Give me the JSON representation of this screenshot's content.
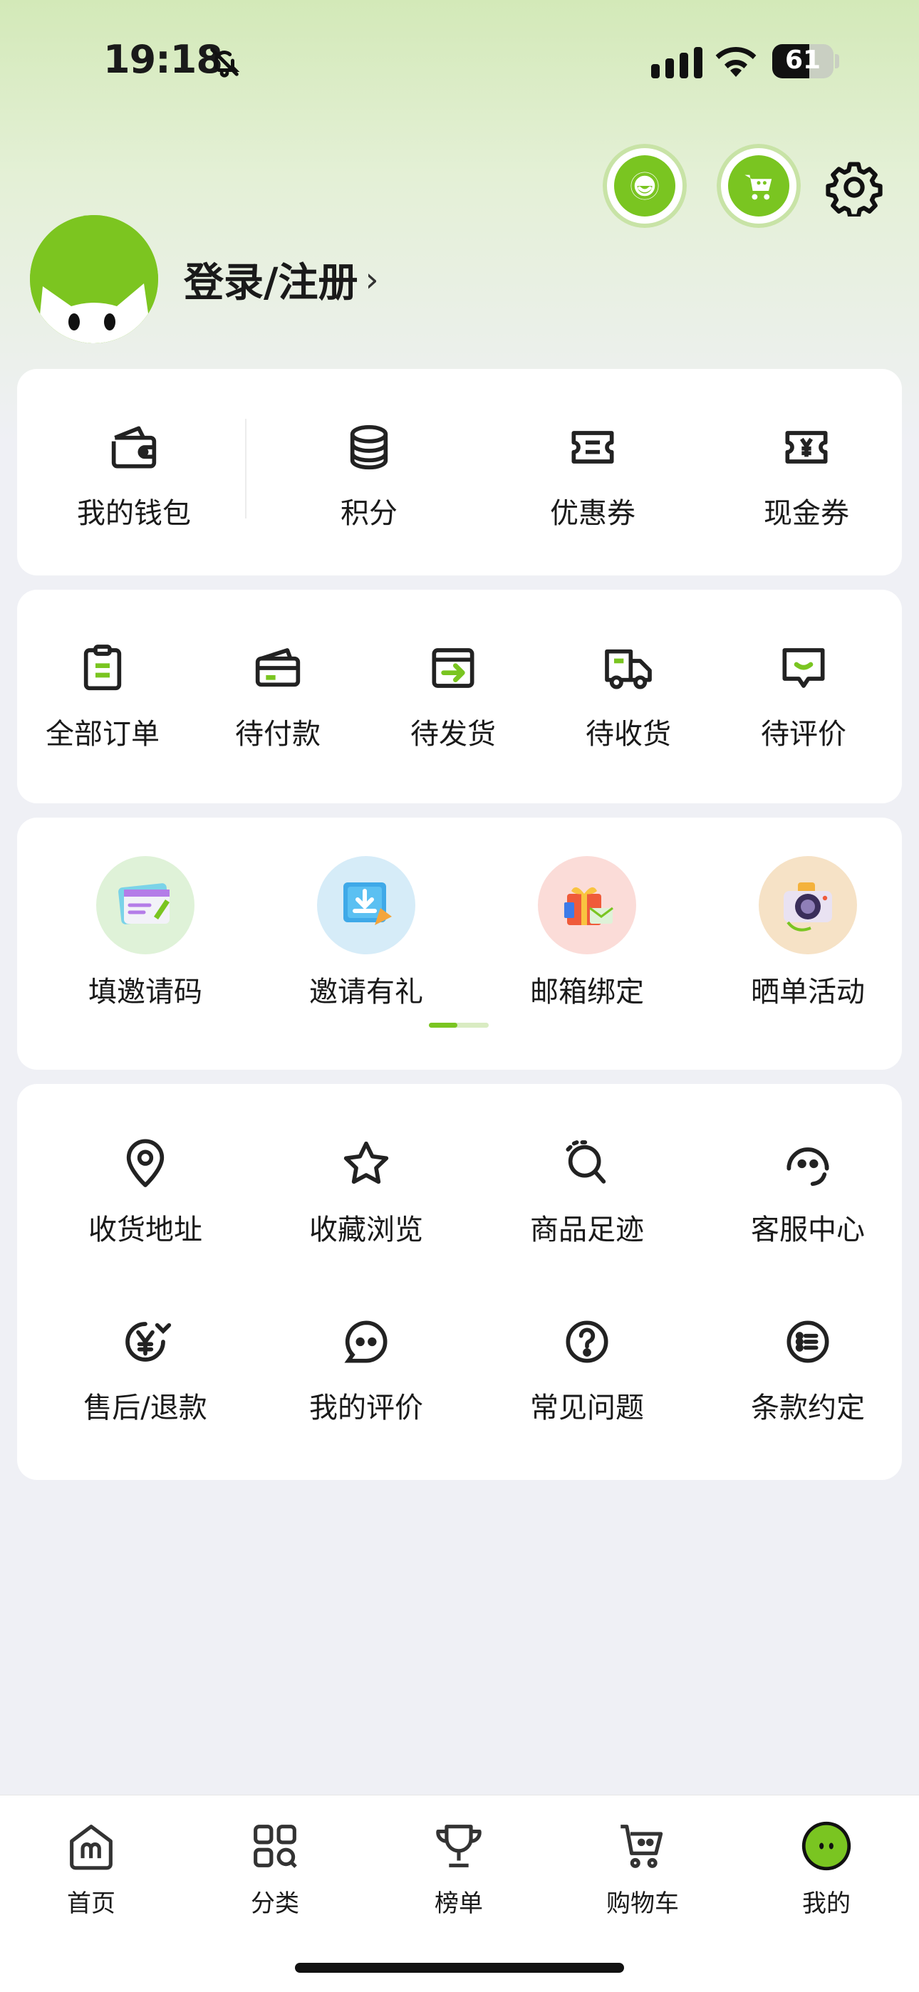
{
  "status_bar": {
    "time": "19:18",
    "battery": "61",
    "battery_level": 0.61
  },
  "header": {
    "login_label": "登录/注册",
    "chevron": "›"
  },
  "colors": {
    "accent": "#7ac521",
    "accent_light": "#c8e3a6",
    "bg": "#eff0f5"
  },
  "wallet_row": [
    {
      "label": "我的钱包",
      "icon": "wallet-icon"
    },
    {
      "label": "积分",
      "icon": "coins-icon"
    },
    {
      "label": "优惠券",
      "icon": "coupon-icon"
    },
    {
      "label": "现金券",
      "icon": "cash-voucher-icon"
    }
  ],
  "orders_row": [
    {
      "label": "全部订单",
      "icon": "clipboard-icon"
    },
    {
      "label": "待付款",
      "icon": "card-icon"
    },
    {
      "label": "待发货",
      "icon": "ship-box-icon"
    },
    {
      "label": "待收货",
      "icon": "truck-icon"
    },
    {
      "label": "待评价",
      "icon": "review-bubble-icon"
    }
  ],
  "promo_row": [
    {
      "label": "填邀请码",
      "icon": "invite-code-icon"
    },
    {
      "label": "邀请有礼",
      "icon": "invite-gift-icon"
    },
    {
      "label": "邮箱绑定",
      "icon": "email-gift-icon"
    },
    {
      "label": "晒单活动",
      "icon": "camera-icon"
    }
  ],
  "services": [
    {
      "label": "收货地址",
      "icon": "location-pin-icon"
    },
    {
      "label": "收藏浏览",
      "icon": "star-icon"
    },
    {
      "label": "商品足迹",
      "icon": "footprint-icon"
    },
    {
      "label": "客服中心",
      "icon": "headset-icon"
    },
    {
      "label": "售后/退款",
      "icon": "refund-icon"
    },
    {
      "label": "我的评价",
      "icon": "chat-icon"
    },
    {
      "label": "常见问题",
      "icon": "question-icon"
    },
    {
      "label": "条款约定",
      "icon": "list-icon"
    }
  ],
  "tabs": [
    {
      "label": "首页",
      "icon": "home-icon"
    },
    {
      "label": "分类",
      "icon": "category-icon"
    },
    {
      "label": "榜单",
      "icon": "trophy-icon"
    },
    {
      "label": "购物车",
      "icon": "cart-icon"
    },
    {
      "label": "我的",
      "icon": "profile-icon"
    }
  ]
}
